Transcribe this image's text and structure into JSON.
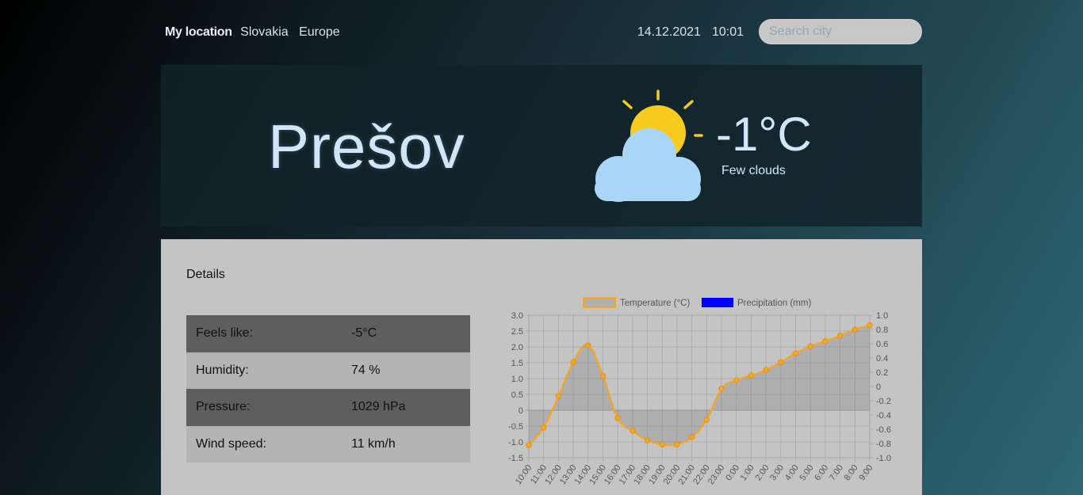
{
  "location": {
    "my_label": "My location",
    "country": "Slovakia",
    "continent": "Europe"
  },
  "datetime": {
    "date": "14.12.2021",
    "time": "10:01"
  },
  "search": {
    "placeholder": "Search city",
    "value": ""
  },
  "hero": {
    "city": "Prešov",
    "temperature": "-1°C",
    "description": "Few clouds",
    "icon": "sun-behind-cloud-icon"
  },
  "details": {
    "title": "Details",
    "rows": [
      {
        "label": "Feels like:",
        "value": "-5°C"
      },
      {
        "label": "Humidity:",
        "value": "74 %"
      },
      {
        "label": "Pressure:",
        "value": "1029 hPa"
      },
      {
        "label": "Wind speed:",
        "value": "11 km/h"
      }
    ]
  },
  "colors": {
    "temperature": "#f5a623",
    "precipitation": "#0000ff",
    "sun": "#f9cb1f",
    "cloud": "#a9d5f6"
  },
  "chart_data": {
    "type": "line",
    "title": "",
    "xlabel": "",
    "ylabel": "",
    "categories": [
      "10:00",
      "11:00",
      "12:00",
      "13:00",
      "14:00",
      "15:00",
      "16:00",
      "17:00",
      "18:00",
      "19:00",
      "20:00",
      "21:00",
      "22:00",
      "23:00",
      "0:00",
      "1:00",
      "2:00",
      "3:00",
      "4:00",
      "5:00",
      "6:00",
      "7:00",
      "8:00",
      "9:00"
    ],
    "series": [
      {
        "name": "Temperature (°C)",
        "axis": "left",
        "type": "area",
        "values": [
          -1.1,
          -0.55,
          0.45,
          1.52,
          2.05,
          1.08,
          -0.25,
          -0.65,
          -0.95,
          -1.08,
          -1.08,
          -0.85,
          -0.3,
          0.68,
          0.95,
          1.1,
          1.27,
          1.52,
          1.8,
          2.02,
          2.18,
          2.35,
          2.55,
          2.68
        ]
      },
      {
        "name": "Precipitation (mm)",
        "axis": "right",
        "type": "bar",
        "values": [
          0,
          0,
          0,
          0,
          0,
          0,
          0,
          0,
          0,
          0,
          0,
          0,
          0,
          0,
          0,
          0,
          0,
          0,
          0,
          0,
          0,
          0,
          0,
          0
        ]
      }
    ],
    "left_axis": {
      "ylim": [
        -1.5,
        3.0
      ],
      "ticks": [
        "3.0",
        "2.5",
        "2.0",
        "1.5",
        "1.0",
        "0.5",
        "0",
        "-0.5",
        "-1.0",
        "-1.5"
      ]
    },
    "right_axis": {
      "ylim": [
        -1.0,
        1.0
      ],
      "ticks": [
        "1.0",
        "0.8",
        "0.6",
        "0.4",
        "0.2",
        "0",
        "-0.2",
        "-0.4",
        "-0.6",
        "-0.8",
        "-1.0"
      ]
    },
    "grid": true,
    "legend": "top"
  }
}
